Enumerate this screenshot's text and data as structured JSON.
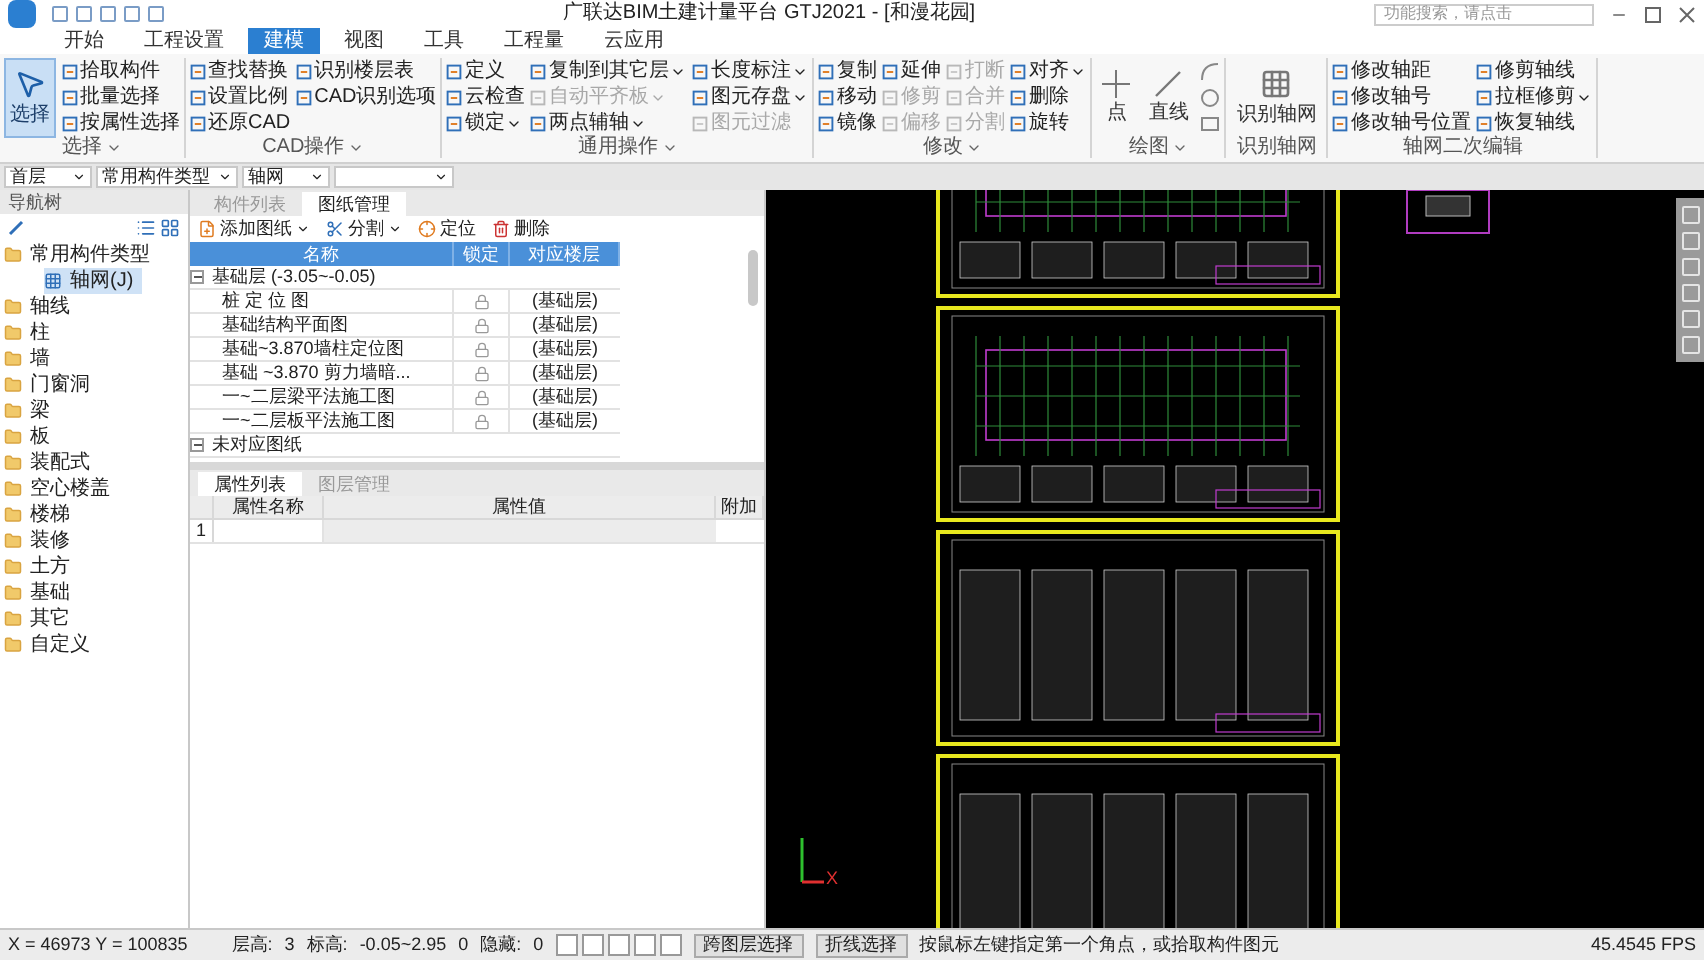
{
  "window": {
    "title": "广联达BIM土建计量平台 GTJ2021 - [和漫花园]"
  },
  "search": {
    "placeholder": "功能搜索，请点击"
  },
  "menu_tabs": [
    {
      "label": "开始",
      "selected": false
    },
    {
      "label": "工程设置",
      "selected": false
    },
    {
      "label": "建模",
      "selected": true
    },
    {
      "label": "视图",
      "selected": false
    },
    {
      "label": "工具",
      "selected": false
    },
    {
      "label": "工程量",
      "selected": false
    },
    {
      "label": "云应用",
      "selected": false
    }
  ],
  "ribbon_groups": [
    {
      "label": "选择",
      "label_dropdown": true,
      "kind": "normal",
      "large": [
        {
          "label": "选择",
          "selected": true
        }
      ],
      "columns": [
        [
          {
            "label": "拾取构件",
            "disabled": false,
            "dropdown": false
          },
          {
            "label": "批量选择",
            "disabled": false,
            "dropdown": false
          },
          {
            "label": "按属性选择",
            "disabled": false,
            "dropdown": false
          }
        ]
      ]
    },
    {
      "label": "CAD操作",
      "label_dropdown": true,
      "kind": "normal",
      "columns": [
        [
          {
            "label": "查找替换",
            "disabled": false,
            "dropdown": false
          },
          {
            "label": "设置比例",
            "disabled": false,
            "dropdown": false
          },
          {
            "label": "还原CAD",
            "disabled": false,
            "dropdown": false
          }
        ],
        [
          {
            "label": "识别楼层表",
            "disabled": false,
            "dropdown": false
          },
          {
            "label": "CAD识别选项",
            "disabled": false,
            "dropdown": false
          }
        ]
      ]
    },
    {
      "label": "通用操作",
      "label_dropdown": true,
      "kind": "normal",
      "columns": [
        [
          {
            "label": "定义",
            "disabled": false,
            "dropdown": false
          },
          {
            "label": "云检查",
            "disabled": false,
            "dropdown": false
          },
          {
            "label": "锁定",
            "disabled": false,
            "dropdown": true
          }
        ],
        [
          {
            "label": "复制到其它层",
            "disabled": false,
            "dropdown": true
          },
          {
            "label": "自动平齐板",
            "disabled": true,
            "dropdown": true
          },
          {
            "label": "两点辅轴",
            "disabled": false,
            "dropdown": true
          }
        ],
        [
          {
            "label": "长度标注",
            "disabled": false,
            "dropdown": true
          },
          {
            "label": "图元存盘",
            "disabled": false,
            "dropdown": true
          },
          {
            "label": "图元过滤",
            "disabled": true,
            "dropdown": false
          }
        ]
      ]
    },
    {
      "label": "修改",
      "label_dropdown": true,
      "kind": "normal",
      "columns": [
        [
          {
            "label": "复制",
            "disabled": false,
            "dropdown": false
          },
          {
            "label": "移动",
            "disabled": false,
            "dropdown": false
          },
          {
            "label": "镜像",
            "disabled": false,
            "dropdown": false
          }
        ],
        [
          {
            "label": "延伸",
            "disabled": false,
            "dropdown": false
          },
          {
            "label": "修剪",
            "disabled": true,
            "dropdown": false
          },
          {
            "label": "偏移",
            "disabled": true,
            "dropdown": false
          }
        ],
        [
          {
            "label": "打断",
            "disabled": true,
            "dropdown": false
          },
          {
            "label": "合并",
            "disabled": true,
            "dropdown": false
          },
          {
            "label": "分割",
            "disabled": true,
            "dropdown": false
          }
        ],
        [
          {
            "label": "对齐",
            "disabled": false,
            "dropdown": true
          },
          {
            "label": "删除",
            "disabled": false,
            "dropdown": false
          },
          {
            "label": "旋转",
            "disabled": false,
            "dropdown": false
          }
        ]
      ]
    },
    {
      "label": "绘图",
      "label_dropdown": true,
      "kind": "draw",
      "large": [
        {
          "label": "点",
          "selected": false
        },
        {
          "label": "直线",
          "selected": false
        }
      ]
    },
    {
      "label": "识别轴网",
      "label_dropdown": false,
      "kind": "normal",
      "large": [
        {
          "label": "识别轴网",
          "selected": false
        }
      ]
    },
    {
      "label": "轴网二次编辑",
      "label_dropdown": false,
      "kind": "normal",
      "columns": [
        [
          {
            "label": "修改轴距",
            "disabled": false,
            "dropdown": false
          },
          {
            "label": "修改轴号",
            "disabled": false,
            "dropdown": false
          },
          {
            "label": "修改轴号位置",
            "disabled": false,
            "dropdown": false
          }
        ],
        [
          {
            "label": "修剪轴线",
            "disabled": false,
            "dropdown": false
          },
          {
            "label": "拉框修剪",
            "disabled": false,
            "dropdown": true
          },
          {
            "label": "恢复轴线",
            "disabled": false,
            "dropdown": false
          }
        ]
      ]
    }
  ],
  "selectors": [
    "首层",
    "常用构件类型",
    "轴网"
  ],
  "nav": {
    "title": "导航树",
    "tree": [
      {
        "label": "常用构件类型",
        "selected": false,
        "children": [
          {
            "label": "轴网(J)",
            "selected": true
          }
        ]
      },
      {
        "label": "轴线",
        "selected": false
      },
      {
        "label": "柱",
        "selected": false
      },
      {
        "label": "墙",
        "selected": false
      },
      {
        "label": "门窗洞",
        "selected": false
      },
      {
        "label": "梁",
        "selected": false
      },
      {
        "label": "板",
        "selected": false
      },
      {
        "label": "装配式",
        "selected": false
      },
      {
        "label": "空心楼盖",
        "selected": false
      },
      {
        "label": "楼梯",
        "selected": false
      },
      {
        "label": "装修",
        "selected": false
      },
      {
        "label": "土方",
        "selected": false
      },
      {
        "label": "基础",
        "selected": false
      },
      {
        "label": "其它",
        "selected": false
      },
      {
        "label": "自定义",
        "selected": false
      }
    ]
  },
  "drawing_panel": {
    "tabs": [
      {
        "label": "构件列表",
        "selected": false
      },
      {
        "label": "图纸管理",
        "selected": true
      }
    ],
    "toolbar": [
      {
        "label": "添加图纸",
        "dropdown": true
      },
      {
        "label": "分割",
        "dropdown": true
      },
      {
        "label": "定位",
        "dropdown": false
      },
      {
        "label": "删除",
        "dropdown": false
      }
    ],
    "columns": [
      "名称",
      "锁定",
      "对应楼层"
    ],
    "groups": [
      {
        "label": "基础层 (-3.05~-0.05)",
        "expanded": true,
        "rows": [
          {
            "name": "桩 定 位 图",
            "floor": "(基础层)"
          },
          {
            "name": "基础结构平面图",
            "floor": "(基础层)"
          },
          {
            "name": "基础~3.870墙柱定位图",
            "floor": "(基础层)"
          },
          {
            "name": "基础 ~3.870 剪力墙暗...",
            "floor": "(基础层)"
          },
          {
            "name": "一~二层梁平法施工图",
            "floor": "(基础层)"
          },
          {
            "name": "一~二层板平法施工图",
            "floor": "(基础层)"
          }
        ]
      },
      {
        "label": "未对应图纸",
        "expanded": true
      }
    ]
  },
  "property_panel": {
    "tabs": [
      {
        "label": "属性列表",
        "selected": true
      },
      {
        "label": "图层管理",
        "selected": false
      }
    ],
    "columns": [
      "属性名称",
      "属性值",
      "附加"
    ],
    "rows": [
      "1"
    ]
  },
  "canvas": {
    "axis_label": "X"
  },
  "status_bar": {
    "fields": [
      "X = 46973 Y = 100835",
      "层高:",
      "3",
      "标高:",
      "-0.05~2.95",
      "0",
      "隐藏:",
      "0"
    ],
    "buttons": [
      "跨图层选择",
      "折线选择"
    ],
    "hint": "按鼠标左键指定第一个角点，或拾取构件图元",
    "fps": "45.4545 FPS"
  }
}
